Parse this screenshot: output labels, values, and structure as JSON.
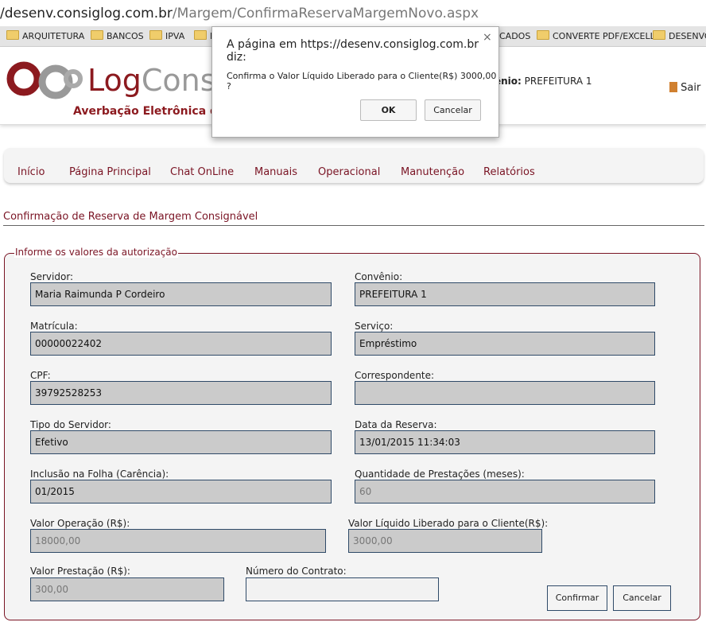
{
  "browser": {
    "url_host": "/desenv.consiglog.com.br",
    "url_path": "/Margem/ConfirmaReservaMargemNovo.aspx",
    "bookmarks": [
      "ARQUITETURA",
      "BANCOS",
      "IPVA",
      "F",
      "CADOS",
      "CONVERTE PDF/EXCELL",
      "DESENVO"
    ]
  },
  "header": {
    "logo_log": "Log",
    "logo_consig": "Consig",
    "tagline": "Averbação Eletrônica de C",
    "convenio_label": "ênio:",
    "convenio_value": "PREFEITURA 1",
    "sair": "Sair"
  },
  "nav": [
    "Início",
    "Página Principal",
    "Chat OnLine",
    "Manuais",
    "Operacional",
    "Manutenção",
    "Relatórios"
  ],
  "page_title": "Confirmação de Reserva de Margem Consignável",
  "form": {
    "legend": "Informe os valores da autorização",
    "fields": [
      {
        "label": "Servidor:",
        "value": "Maria Raimunda P Cordeiro"
      },
      {
        "label": "Convênio:",
        "value": "PREFEITURA 1"
      },
      {
        "label": "Matrícula:",
        "value": "00000022402"
      },
      {
        "label": "Serviço:",
        "value": "Empréstimo"
      },
      {
        "label": "CPF:",
        "value": "39792528253"
      },
      {
        "label": "Correspondente:",
        "value": ""
      },
      {
        "label": "Tipo do Servidor:",
        "value": "Efetivo"
      },
      {
        "label": "Data da Reserva:",
        "value": "13/01/2015 11:34:03"
      },
      {
        "label": "Inclusão na Folha (Carência):",
        "value": "01/2015"
      },
      {
        "label": "Quantidade de Prestações (meses):",
        "value": "60"
      },
      {
        "label": "Valor Operação (R$):",
        "value": "18000,00"
      },
      {
        "label": "Valor Líquido Liberado para o Cliente(R$):",
        "value": "3000,00"
      },
      {
        "label": "Valor Prestação (R$):",
        "value": "300,00"
      },
      {
        "label": "Número do Contrato:",
        "value": ""
      }
    ],
    "confirm": "Confirmar",
    "cancel": "Cancelar"
  },
  "dialog": {
    "title": "A página em https://desenv.consiglog.com.br diz:",
    "message": "Confirma o Valor Líquido Liberado para o Cliente(R$) 3000,00 ?",
    "ok": "OK",
    "cancel": "Cancelar",
    "close": "×"
  },
  "colors": {
    "brand": "#8c1a1f",
    "input_border": "#2f4a68",
    "input_bg": "#cbcbcb"
  }
}
